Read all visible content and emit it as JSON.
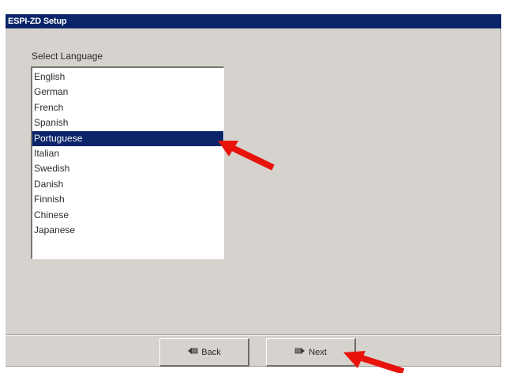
{
  "window": {
    "title": "ESPI-ZD Setup"
  },
  "language": {
    "label": "Select Language",
    "items": [
      "English",
      "German",
      "French",
      "Spanish",
      "Portuguese",
      "Italian",
      "Swedish",
      "Danish",
      "Finnish",
      "Chinese",
      "Japanese"
    ],
    "selected": "Portuguese"
  },
  "buttons": {
    "back_label": "Back",
    "next_label": "Next",
    "back_icon": "back-arrow-icon",
    "next_icon": "next-arrow-icon"
  },
  "annotations": {
    "arrow_color": "#e8140c"
  },
  "colors": {
    "titlebar": "#0a246a",
    "selection": "#0a246a",
    "window_bg": "#d6d3ce"
  }
}
